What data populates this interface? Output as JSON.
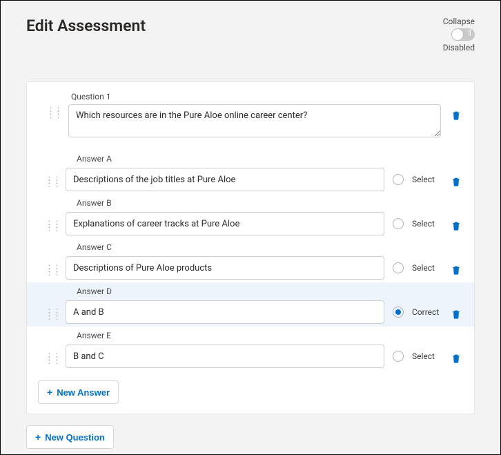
{
  "header": {
    "title": "Edit Assessment",
    "collapse_label": "Collapse",
    "collapse_state_label": "Disabled"
  },
  "question": {
    "label": "Question 1",
    "text": "Which resources are in the Pure Aloe online career center?"
  },
  "answers": [
    {
      "label": "Answer A",
      "text": "Descriptions of the job titles at Pure Aloe",
      "selectLabel": "Select",
      "correct": false
    },
    {
      "label": "Answer B",
      "text": "Explanations of career tracks at Pure Aloe",
      "selectLabel": "Select",
      "correct": false
    },
    {
      "label": "Answer C",
      "text": "Descriptions of Pure Aloe products",
      "selectLabel": "Select",
      "correct": false
    },
    {
      "label": "Answer D",
      "text": "A and B",
      "selectLabel": "Correct",
      "correct": true
    },
    {
      "label": "Answer E",
      "text": "B and C",
      "selectLabel": "Select",
      "correct": false
    }
  ],
  "buttons": {
    "new_answer": "New Answer",
    "new_question": "New Question"
  }
}
